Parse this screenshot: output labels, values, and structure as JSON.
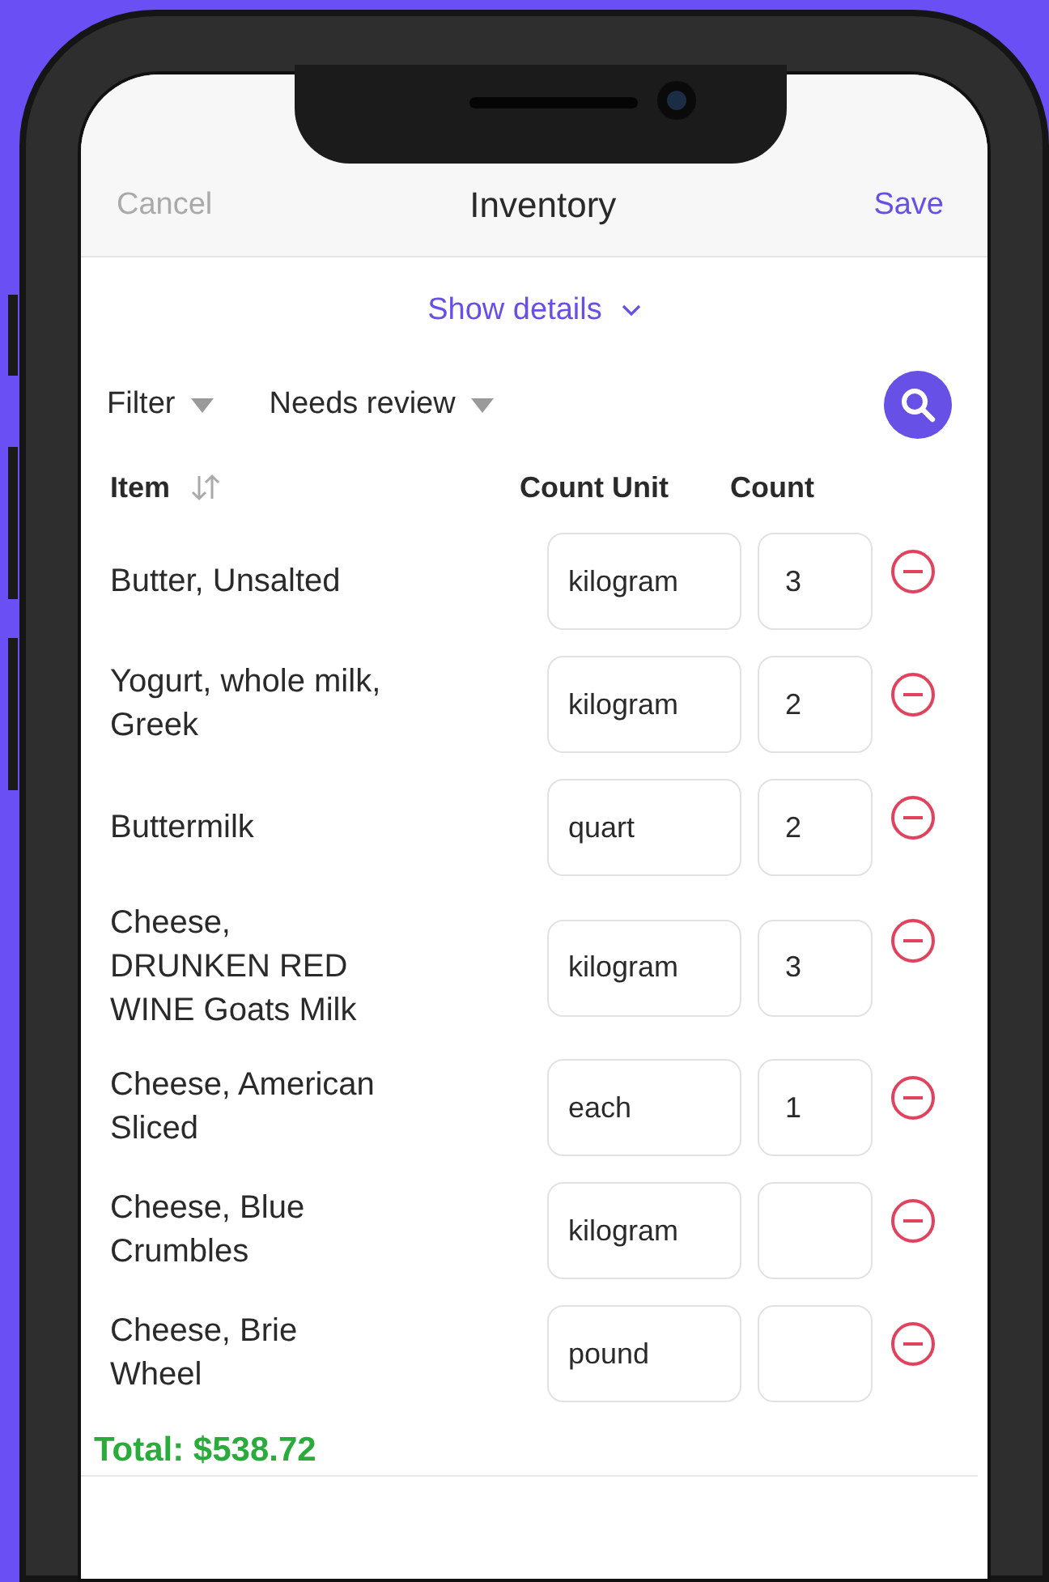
{
  "header": {
    "cancel": "Cancel",
    "title": "Inventory",
    "save": "Save"
  },
  "show_details": {
    "label": "Show details",
    "expanded": false
  },
  "filters": [
    {
      "label": "Filter"
    },
    {
      "label": "Needs review"
    }
  ],
  "columns": [
    {
      "label": "Item",
      "sortable": true
    },
    {
      "label": "Count Unit",
      "sortable": false
    },
    {
      "label": "Count",
      "sortable": false
    }
  ],
  "rows": [
    {
      "name": "Butter, Unsalted",
      "unit": "kilogram",
      "count": "3"
    },
    {
      "name": "Yogurt, whole milk, Greek",
      "unit": "kilogram",
      "count": "2"
    },
    {
      "name": "Buttermilk",
      "unit": "quart",
      "count": "2"
    },
    {
      "name": "Cheese, DRUNKEN RED WINE Goats Milk",
      "unit": "kilogram",
      "count": "3"
    },
    {
      "name": "Cheese, American Sliced",
      "unit": "each",
      "count": "1"
    },
    {
      "name": "Cheese, Blue Crumbles",
      "unit": "kilogram"
    },
    {
      "name": "Cheese, Brie Wheel",
      "unit": "pound"
    }
  ],
  "total": "Total: $538.72"
}
